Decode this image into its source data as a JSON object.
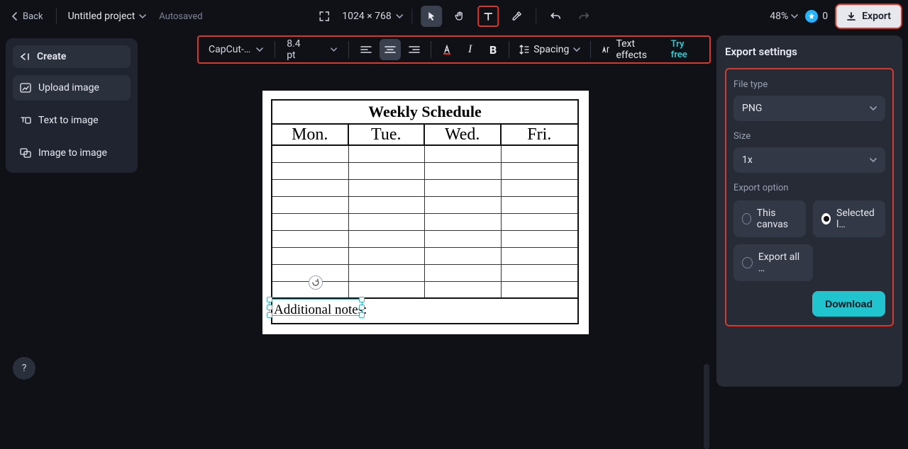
{
  "header": {
    "back": "Back",
    "project": "Untitled project",
    "status": "Autosaved",
    "canvas_size": "1024 × 768",
    "zoom": "48%",
    "credits": "0",
    "export": "Export"
  },
  "toolbar": {
    "font": "CapCut-…",
    "font_size": "8.4 pt",
    "spacing_label": "Spacing",
    "effects_label": "Text effects",
    "try_free": "Try free"
  },
  "sidebar": {
    "create": "Create",
    "items": [
      {
        "label": "Upload image"
      },
      {
        "label": "Text to image"
      },
      {
        "label": "Image to image"
      }
    ]
  },
  "canvas": {
    "title": "Weekly Schedule",
    "headers": [
      "Mon.",
      "Tue.",
      "Wed.",
      "Fri."
    ],
    "selected_text": "Additional notes:"
  },
  "export_panel": {
    "title": "Export settings",
    "file_type_label": "File type",
    "file_type_value": "PNG",
    "size_label": "Size",
    "size_value": "1x",
    "option_label": "Export option",
    "opt_canvas": "This canvas",
    "opt_selected": "Selected l…",
    "opt_all": "Export all …",
    "download": "Download"
  }
}
